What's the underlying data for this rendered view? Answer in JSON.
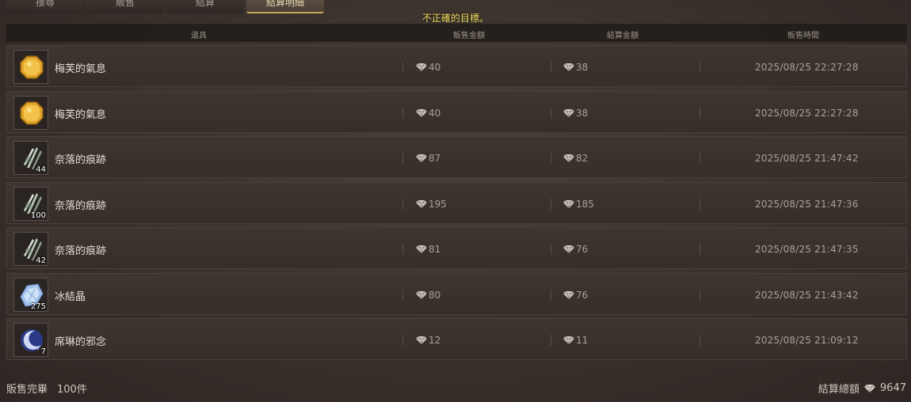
{
  "tabs": [
    {
      "label": "搜尋",
      "active": false
    },
    {
      "label": "販售",
      "active": false
    },
    {
      "label": "結算",
      "active": false
    },
    {
      "label": "結算明細",
      "active": true
    }
  ],
  "warning": "不正確的目標。",
  "columns": {
    "item": "道具",
    "sale_price": "販售金額",
    "settle_price": "結算金額",
    "sale_time": "販售時間"
  },
  "rows": [
    {
      "icon": "amber-orb-icon",
      "qty": "",
      "name": "梅芙的氣息",
      "sale": "40",
      "settle": "38",
      "time": "2025/08/25 22:27:28"
    },
    {
      "icon": "amber-orb-icon",
      "qty": "",
      "name": "梅芙的氣息",
      "sale": "40",
      "settle": "38",
      "time": "2025/08/25 22:27:28"
    },
    {
      "icon": "claw-mark-icon",
      "qty": "44",
      "name": "奈落的痕跡",
      "sale": "87",
      "settle": "82",
      "time": "2025/08/25 21:47:42"
    },
    {
      "icon": "claw-mark-icon",
      "qty": "100",
      "name": "奈落的痕跡",
      "sale": "195",
      "settle": "185",
      "time": "2025/08/25 21:47:36"
    },
    {
      "icon": "claw-mark-icon",
      "qty": "42",
      "name": "奈落的痕跡",
      "sale": "81",
      "settle": "76",
      "time": "2025/08/25 21:47:35"
    },
    {
      "icon": "ice-crystal-icon",
      "qty": "275",
      "name": "冰結晶",
      "sale": "80",
      "settle": "76",
      "time": "2025/08/25 21:43:42"
    },
    {
      "icon": "crescent-moon-icon",
      "qty": "7",
      "name": "席琳的邪念",
      "sale": "12",
      "settle": "11",
      "time": "2025/08/25 21:09:12"
    }
  ],
  "footer": {
    "sold_label": "販售完畢",
    "sold_count": "100件",
    "total_label": "結算總額",
    "total_value": "9647"
  },
  "colors": {
    "accent": "#c9a85a",
    "warning": "#f0e060"
  }
}
